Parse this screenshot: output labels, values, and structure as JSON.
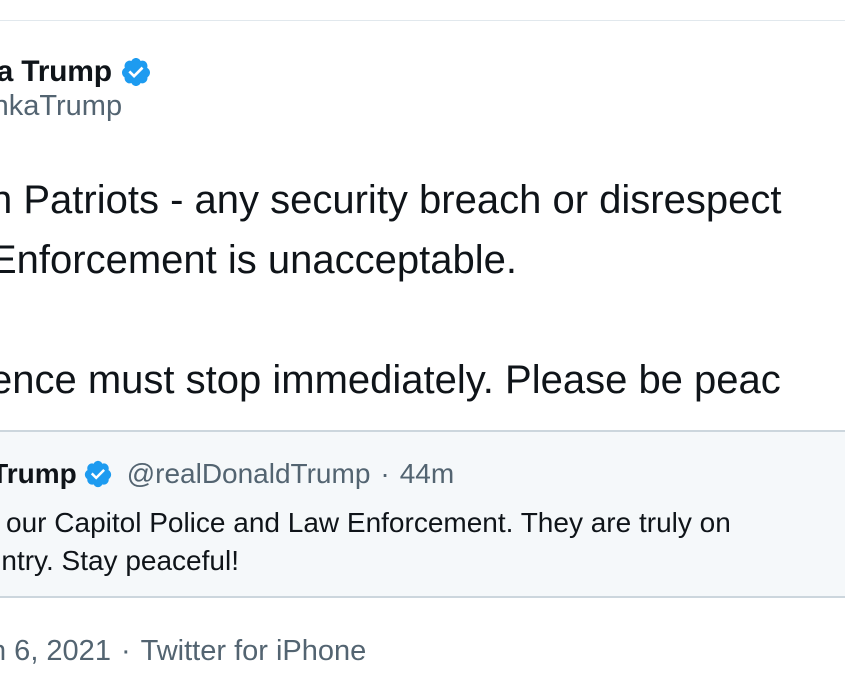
{
  "author": {
    "name": "nka Trump",
    "handle": "vankaTrump",
    "verified_color": "#1d9bf0"
  },
  "tweet": {
    "lines": [
      "n Patriots - any security breach or disrespect",
      "Enforcement is unacceptable.",
      "",
      "ence must stop immediately. Please be peac"
    ]
  },
  "quoted_tweet": {
    "name": "J. Trump",
    "handle": "@realDonaldTrump",
    "separator": "·",
    "time": "44m",
    "lines": [
      "port our Capitol Police and Law Enforcement. They are truly on",
      "Country. Stay peaceful!"
    ]
  },
  "meta": {
    "date": "n 6, 2021",
    "separator": "·",
    "source": "Twitter for iPhone"
  },
  "icons": {
    "verified": "verified-badge-icon"
  }
}
